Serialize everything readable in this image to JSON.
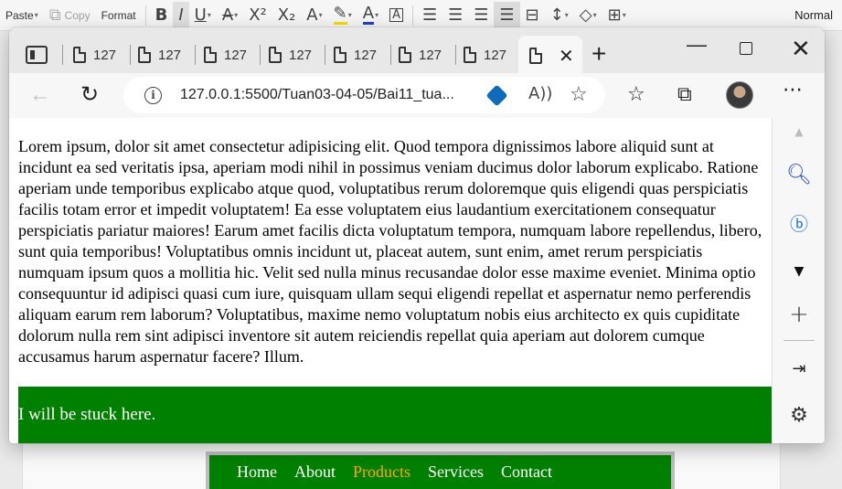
{
  "ribbon": {
    "paste": "Paste",
    "copy": "Copy",
    "format": "Format",
    "style_normal": "Normal",
    "icons": [
      "bold-icon",
      "italic-icon",
      "underline-icon",
      "strikethrough-icon",
      "superscript-icon",
      "subscript-icon",
      "text-effect-icon",
      "highlight-icon",
      "font-color-icon",
      "character-border-icon",
      "align-left-icon",
      "align-center-icon",
      "align-right-icon",
      "justify-icon",
      "distributed-icon",
      "line-spacing-icon",
      "shading-icon",
      "borders-icon"
    ]
  },
  "browser": {
    "tabs": [
      {
        "label": "127"
      },
      {
        "label": "127"
      },
      {
        "label": "127"
      },
      {
        "label": "127"
      },
      {
        "label": "127"
      },
      {
        "label": "127"
      },
      {
        "label": "127"
      }
    ],
    "address": "127.0.0.1:5500/Tuan03-04-05/Bai11_tua...",
    "content": {
      "paragraph": "Lorem ipsum, dolor sit amet consectetur adipisicing elit. Quod tempora dignissimos labore aliquid sunt at incidunt ea sed veritatis ipsa, aperiam modi nihil in possimus veniam ducimus dolor laborum explicabo. Ratione aperiam unde temporibus explicabo atque quod, voluptatibus rerum doloremque quis eligendi quas perspiciatis facilis totam error et impedit voluptatem! Ea esse voluptatem eius laudantium exercitationem consequatur perspiciatis pariatur maiores! Earum amet facilis dicta voluptatum tempora, numquam labore repellendus, libero, sunt quia temporibus! Voluptatibus omnis incidunt ut, placeat autem, sunt enim, amet rerum perspiciatis numquam ipsum quos a mollitia hic. Velit sed nulla minus recusandae dolor esse maxime eveniet. Minima optio consequuntur id adipisci quasi cum iure, quisquam ullam sequi eligendi repellat et aspernatur nemo perferendis aliquam earum rem laborum? Voluptatibus, maxime nemo voluptatum nobis eius architecto ex quis cupiditate dolorum nulla rem sint adipisci inventore sit autem reiciendis repellat quia aperiam aut dolorem cumque accusamus harum aspernatur facere? Illum.",
      "sticky_text": "I will be stuck here."
    },
    "accent_green": "#008000"
  },
  "background_nav": {
    "items": [
      "Home",
      "About",
      "Products",
      "Services",
      "Contact"
    ],
    "active_color": "#ffa500"
  }
}
